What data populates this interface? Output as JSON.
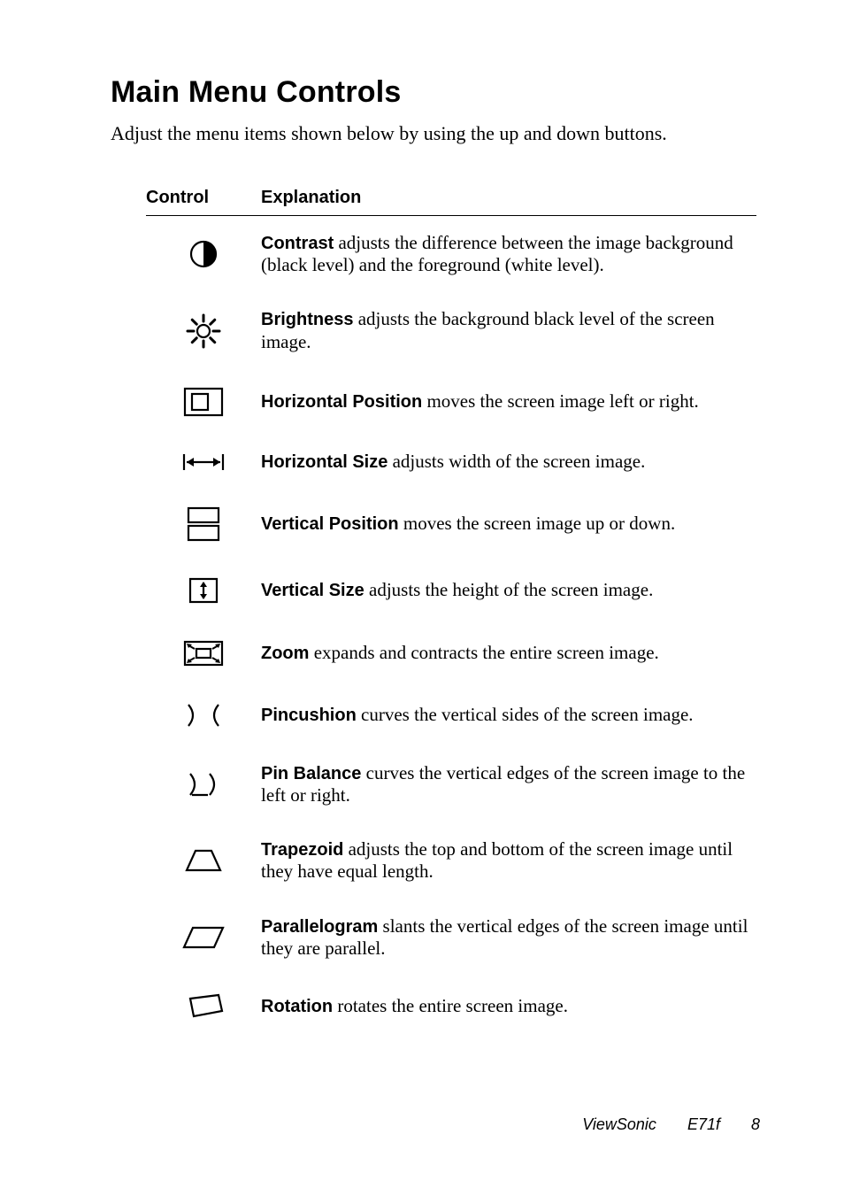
{
  "title": "Main Menu Controls",
  "intro": "Adjust the menu items shown below by using the up and down buttons.",
  "headers": {
    "control": "Control",
    "explanation": "Explanation"
  },
  "rows": [
    {
      "icon": "contrast",
      "term": "Contrast",
      "desc": " adjusts the difference between the image background (black level) and the foreground (white level)."
    },
    {
      "icon": "brightness",
      "term": "Brightness",
      "desc": " adjusts the background black level of the screen image."
    },
    {
      "icon": "hpos",
      "term": "Horizontal Position",
      "desc": " moves the screen image left or right."
    },
    {
      "icon": "hsize",
      "term": "Horizontal Size",
      "desc": " adjusts width of the screen image."
    },
    {
      "icon": "vpos",
      "term": "Vertical Position",
      "desc": " moves the screen image up or down."
    },
    {
      "icon": "vsize",
      "term": "Vertical Size",
      "desc": " adjusts the height of the screen image."
    },
    {
      "icon": "zoom",
      "term": "Zoom",
      "desc": " expands and contracts the entire screen image."
    },
    {
      "icon": "pincushion",
      "term": "Pincushion",
      "desc": " curves the vertical sides of the screen image."
    },
    {
      "icon": "pinbalance",
      "term": "Pin Balance",
      "desc": " curves the vertical edges of the screen image to the left or right."
    },
    {
      "icon": "trapezoid",
      "term": "Trapezoid",
      "desc": " adjusts the top and bottom of the screen image until they have equal length."
    },
    {
      "icon": "parallelogram",
      "term": "Parallelogram",
      "desc": " slants the vertical edges of the screen image until they are parallel."
    },
    {
      "icon": "rotation",
      "term": "Rotation",
      "desc": " rotates the entire screen image."
    }
  ],
  "footer": {
    "brand": "ViewSonic",
    "model": "E71f",
    "page": "8"
  }
}
